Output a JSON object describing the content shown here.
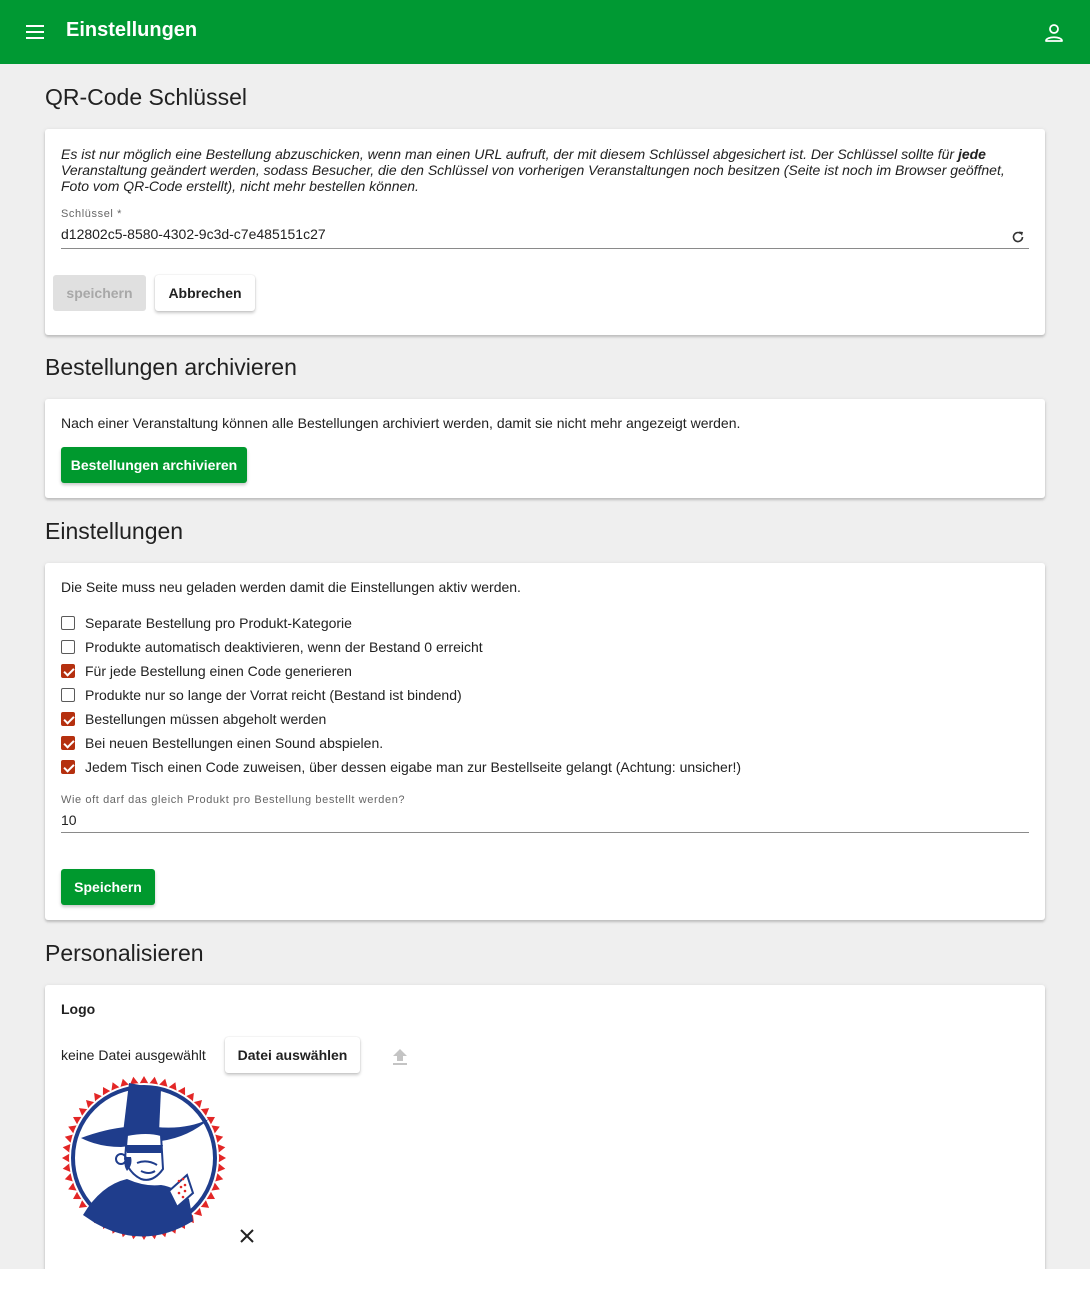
{
  "toolbar": {
    "title": "Einstellungen",
    "menu_icon": "menu-icon",
    "account_icon": "account-icon"
  },
  "qr": {
    "title": "QR-Code Schlüssel",
    "info_part1": "Es ist nur möglich eine Bestellung abzuschicken, wenn man einen URL aufruft, der mit diesem Schlüssel abgesichert ist. Der Schlüssel sollte für ",
    "info_bold": "jede",
    "info_part2": " Veranstaltung geändert werden, sodass Besucher, die den Schlüssel von vorherigen Veranstaltungen noch besitzen (Seite ist noch im Browser geöffnet, Foto vom QR-Code erstellt), nicht mehr bestellen können.",
    "key_label": "Schlüssel *",
    "key_value": "d12802c5-8580-4302-9c3d-c7e485151c27",
    "save_label": "speichern",
    "cancel_label": "Abbrechen"
  },
  "archive": {
    "title": "Bestellungen archivieren",
    "text": "Nach einer Veranstaltung können alle Bestellungen archiviert werden, damit sie nicht mehr angezeigt werden.",
    "button_label": "Bestellungen archivieren"
  },
  "settings": {
    "title": "Einstellungen",
    "text": "Die Seite muss neu geladen werden damit die Einstellungen aktiv werden.",
    "options": [
      {
        "label": "Separate Bestellung pro Produkt-Kategorie",
        "checked": false
      },
      {
        "label": "Produkte automatisch deaktivieren, wenn der Bestand 0 erreicht",
        "checked": false
      },
      {
        "label": "Für jede Bestellung einen Code generieren",
        "checked": true
      },
      {
        "label": "Produkte nur so lange der Vorrat reicht (Bestand ist bindend)",
        "checked": false
      },
      {
        "label": "Bestellungen müssen abgeholt werden",
        "checked": true
      },
      {
        "label": "Bei neuen Bestellungen einen Sound abspielen.",
        "checked": true
      },
      {
        "label": "Jedem Tisch einen Code zuweisen, über dessen eigabe man zur Bestellseite gelangt (Achtung: unsicher!)",
        "checked": true
      }
    ],
    "max_label": "Wie oft darf das gleich Produkt pro Bestellung bestellt werden?",
    "max_value": "10",
    "save_label": "Speichern"
  },
  "personalize": {
    "title": "Personalisieren",
    "logo_label": "Logo",
    "file_status": "keine Datei ausgewählt",
    "choose_label": "Datei auswählen",
    "upload_icon": "upload-icon",
    "remove_icon": "close-icon"
  },
  "colors": {
    "primary": "#009933",
    "checkbox": "#b5300f",
    "logo_blue": "#1f3d8c",
    "logo_red": "#e32626"
  }
}
